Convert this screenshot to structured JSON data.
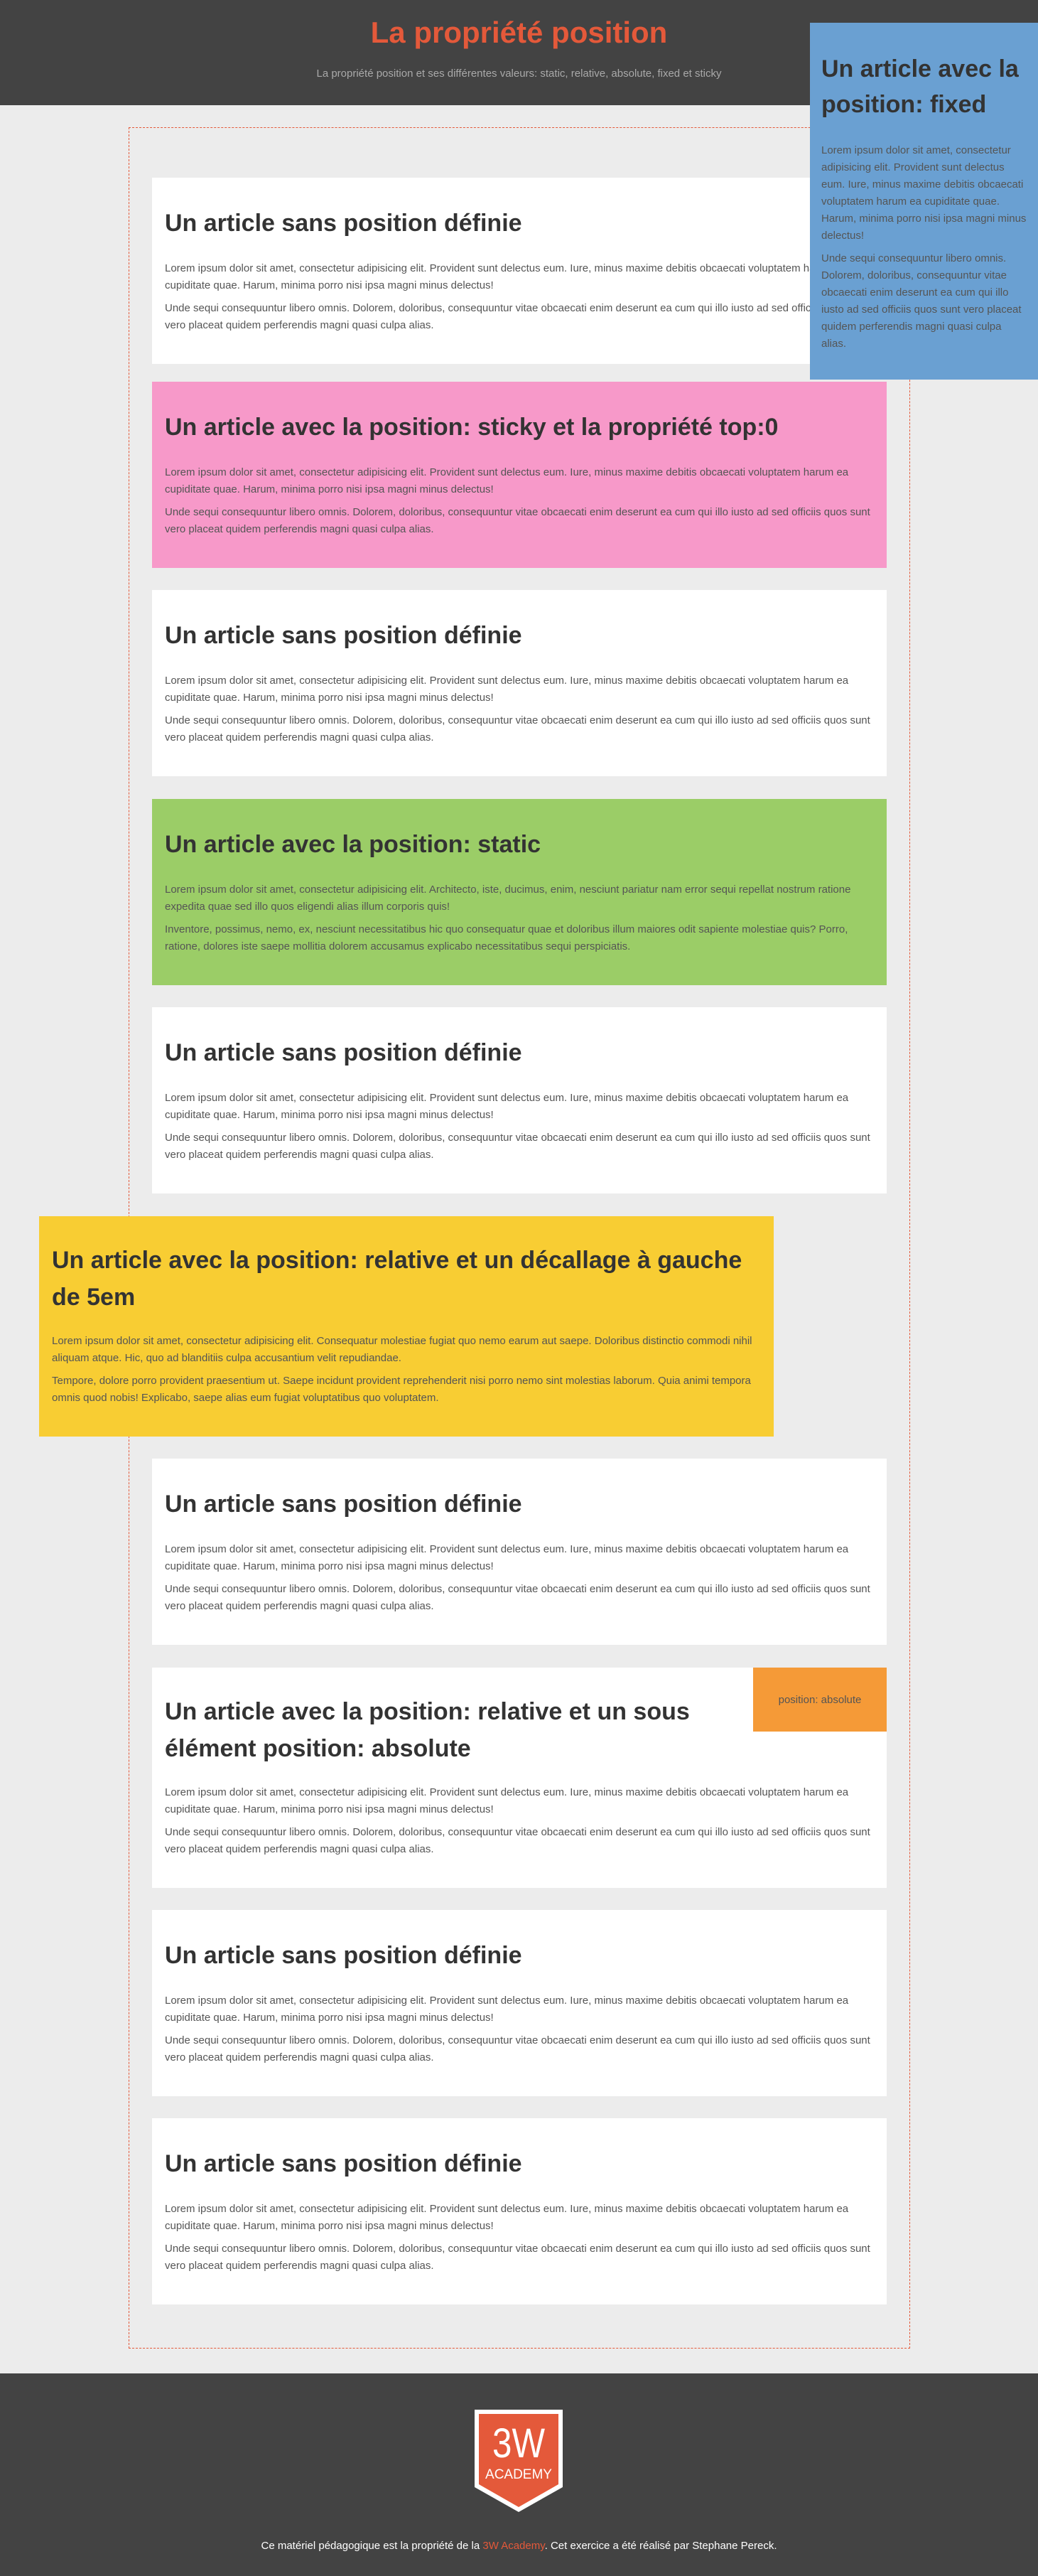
{
  "header": {
    "title": "La propriété position",
    "subtitle": "La propriété position et ses différentes valeurs: static, relative, absolute, fixed et sticky"
  },
  "lorem": {
    "p1": "Lorem ipsum dolor sit amet, consectetur adipisicing elit. Provident sunt delectus eum. Iure, minus maxime debitis obcaecati voluptatem harum ea cupiditate quae. Harum, minima porro nisi ipsa magni minus delectus!",
    "p2": "Unde sequi consequuntur libero omnis. Dolorem, doloribus, consequuntur vitae obcaecati enim deserunt ea cum qui illo iusto ad sed officiis quos sunt vero placeat quidem perferendis magni quasi culpa alias."
  },
  "plain_title": "Un article sans position définie",
  "sticky": {
    "title": "Un article avec la position: sticky et la propriété top:0"
  },
  "static": {
    "title": "Un article avec la position: static",
    "p1": "Lorem ipsum dolor sit amet, consectetur adipisicing elit. Architecto, iste, ducimus, enim, nesciunt pariatur nam error sequi repellat nostrum ratione expedita quae sed illo quos eligendi alias illum corporis quis!",
    "p2": "Inventore, possimus, nemo, ex, nesciunt necessitatibus hic quo consequatur quae et doloribus illum maiores odit sapiente molestiae quis? Porro, ratione, dolores iste saepe mollitia dolorem accusamus explicabo necessitatibus sequi perspiciatis."
  },
  "relative_left": {
    "title": "Un article avec la position: relative et un décallage à gauche de 5em",
    "p1": "Lorem ipsum dolor sit amet, consectetur adipisicing elit. Consequatur molestiae fugiat quo nemo earum aut saepe. Doloribus distinctio commodi nihil aliquam atque. Hic, quo ad blanditiis culpa accusantium velit repudiandae.",
    "p2": "Tempore, dolore porro provident praesentium ut. Saepe incidunt provident reprehenderit nisi porro nemo sint molestias laborum. Quia animi tempora omnis quod nobis! Explicabo, saepe alias eum fugiat voluptatibus quo voluptatem."
  },
  "relative_abs": {
    "title": "Un article avec la position: relative et un sous élément position: absolute",
    "abs_label": "position: absolute"
  },
  "fixed": {
    "title": "Un article avec la position: fixed"
  },
  "footer": {
    "logo_top": "3W",
    "logo_bottom": "ACADEMY",
    "text_before": "Ce matériel pédagogique est la propriété de la ",
    "link": "3W Academy",
    "text_after": ". Cet exercice a été réalisé par Stephane Pereck."
  },
  "colors": {
    "accent": "#e4593a",
    "header_bg": "#434343",
    "sticky_bg": "#f799c9",
    "static_bg": "#9bcd67",
    "relative_bg": "#f8cd33",
    "absolute_bg": "#f59a37",
    "fixed_bg": "#6aa0d2"
  }
}
